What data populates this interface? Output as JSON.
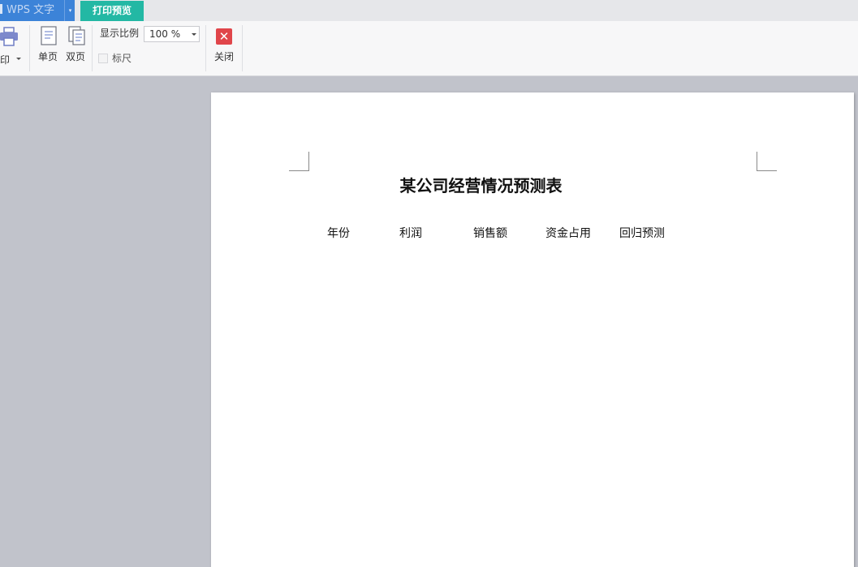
{
  "app_menu": {
    "label": "WPS 文字",
    "arrow": "▾"
  },
  "tabs": [
    {
      "label": "打印预览",
      "active": true
    }
  ],
  "ribbon": {
    "print_label": "打印",
    "single_page_label": "单页",
    "double_page_label": "双页",
    "zoom_label": "显示比例",
    "zoom_value": "100 %",
    "ruler_label": "标尺",
    "ruler_checked": false,
    "close_label": "关闭"
  },
  "document": {
    "title": "某公司经营情况预测表",
    "columns": [
      "年份",
      "利润",
      "销售额",
      "资金占用",
      "回归预测"
    ]
  },
  "colors": {
    "app_menu_bg": "#3c83d8",
    "active_tab_bg": "#23b8a4",
    "close_icon_bg": "#e0454a",
    "workspace_bg": "#c1c3cb"
  },
  "icons": {
    "printer": "printer-icon",
    "single_page": "single-page-icon",
    "double_page": "double-page-icon",
    "close": "close-icon"
  }
}
